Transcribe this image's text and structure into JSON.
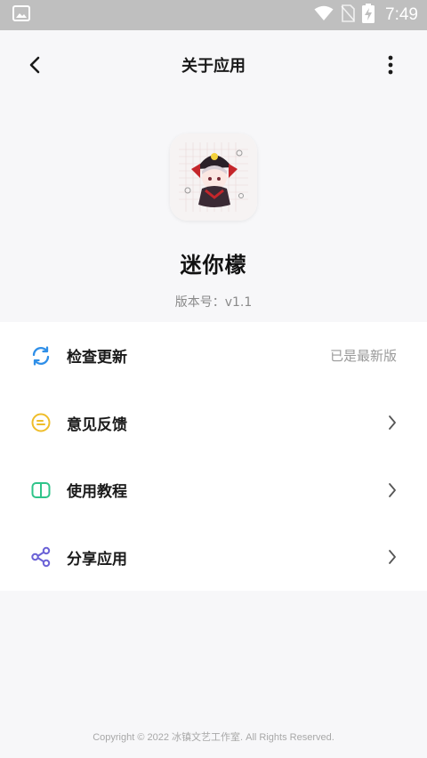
{
  "status_bar": {
    "time": "7:49",
    "icons": [
      "image-notification-icon",
      "wifi-icon",
      "no-sim-icon",
      "battery-charging-icon"
    ]
  },
  "header": {
    "title": "关于应用",
    "back_icon": "chevron-left-icon",
    "more_icon": "more-vertical-icon"
  },
  "app": {
    "name": "迷你檬",
    "version": "版本号：v1.1",
    "icon": "app-logo-chibi-character"
  },
  "menu": {
    "items": [
      {
        "label": "检查更新",
        "status": "已是最新版",
        "icon": "refresh-icon",
        "color": "#2f8fe8"
      },
      {
        "label": "意见反馈",
        "icon": "feedback-icon",
        "color": "#efbd2a",
        "arrow": "chevron-right-icon"
      },
      {
        "label": "使用教程",
        "icon": "book-icon",
        "color": "#2fc48a",
        "arrow": "chevron-right-icon"
      },
      {
        "label": "分享应用",
        "icon": "share-icon",
        "color": "#6b62d6",
        "arrow": "chevron-right-icon"
      }
    ]
  },
  "footer": {
    "copyright": "Copyright © 2022 冰镇文艺工作室. All Rights Reserved."
  }
}
